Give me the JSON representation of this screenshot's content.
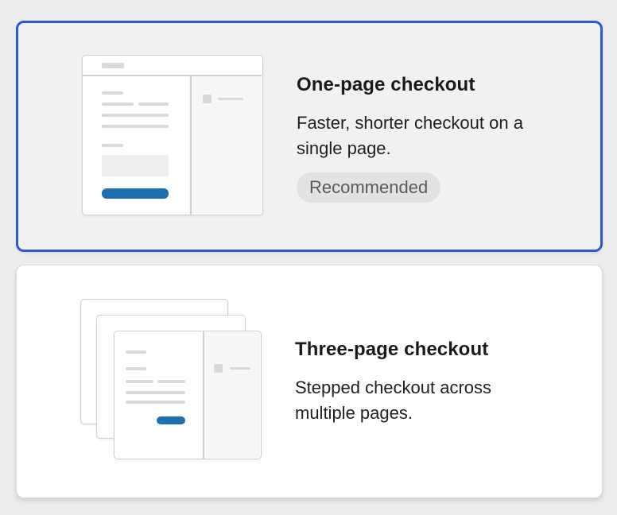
{
  "options": [
    {
      "title": "One-page checkout",
      "description": "Faster, shorter checkout on a single page.",
      "badge": "Recommended",
      "selected": true,
      "illustration": "one-page-checkout-illustration"
    },
    {
      "title": "Three-page checkout",
      "description": "Stepped checkout across multiple pages.",
      "selected": false,
      "illustration": "three-page-checkout-illustration"
    }
  ],
  "colors": {
    "selected_border": "#2a5bd0",
    "mock_button": "#1f6fae",
    "badge_bg": "#e2e2e2"
  }
}
